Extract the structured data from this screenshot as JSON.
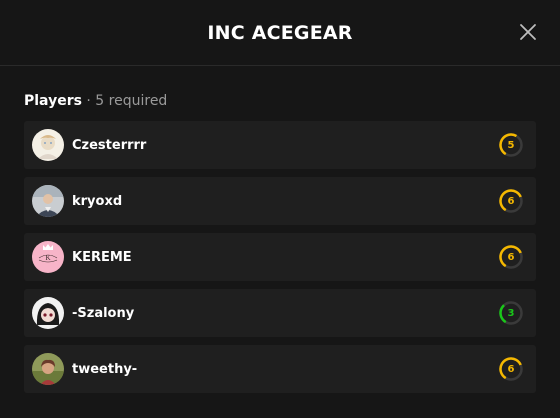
{
  "modal": {
    "title": "INC ACEGEAR",
    "close_icon": "close-icon"
  },
  "players_section": {
    "label": "Players",
    "separator": " · ",
    "required_text": "5 required"
  },
  "colors": {
    "level_high": "#f5b800",
    "level_low": "#19c719",
    "level_track": "#3a3a3a"
  },
  "players": [
    {
      "name": "Czesterrrr",
      "level": "5",
      "level_fraction": 0.5,
      "level_color": "#f5b800",
      "has_crown": false
    },
    {
      "name": "kryoxd",
      "level": "6",
      "level_fraction": 0.6,
      "level_color": "#f5b800",
      "has_crown": false
    },
    {
      "name": "KEREME",
      "level": "6",
      "level_fraction": 0.6,
      "level_color": "#f5b800",
      "has_crown": true
    },
    {
      "name": "-Szalony",
      "level": "3",
      "level_fraction": 0.3,
      "level_color": "#19c719",
      "has_crown": false
    },
    {
      "name": "tweethy-",
      "level": "6",
      "level_fraction": 0.6,
      "level_color": "#f5b800",
      "has_crown": false
    }
  ]
}
